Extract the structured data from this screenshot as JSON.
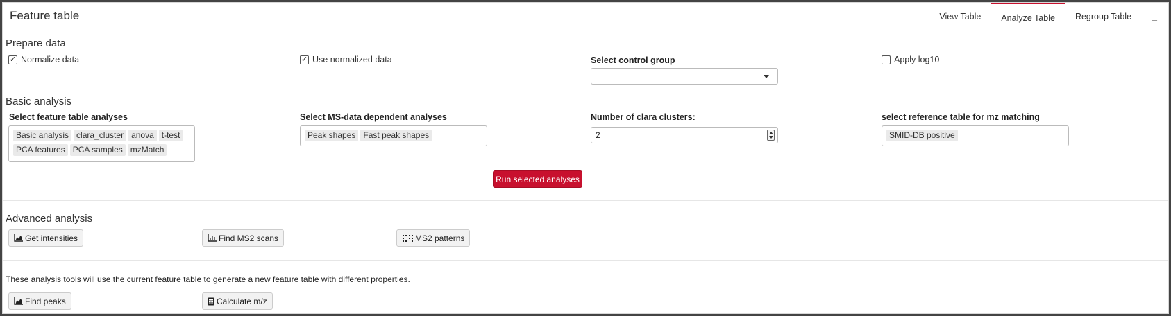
{
  "header": {
    "title": "Feature table",
    "tabs": [
      "View Table",
      "Analyze Table",
      "Regroup Table"
    ],
    "minimize": "_"
  },
  "prepare": {
    "title": "Prepare data",
    "normalize": "Normalize data",
    "use_normalized": "Use normalized data",
    "control_group_label": "Select control group",
    "control_group_value": "",
    "log10": "Apply log10"
  },
  "basic": {
    "title": "Basic analysis",
    "ft_label": "Select feature table analyses",
    "ft_tags": [
      "Basic analysis",
      "clara_cluster",
      "anova",
      "t-test",
      "PCA features",
      "PCA samples",
      "mzMatch"
    ],
    "ms_label": "Select MS-data dependent analyses",
    "ms_tags": [
      "Peak shapes",
      "Fast peak shapes"
    ],
    "clara_label": "Number of clara clusters:",
    "clara_value": "2",
    "ref_label": "select reference table for mz matching",
    "ref_tags": [
      "SMID-DB positive"
    ],
    "run_button": "Run selected analyses"
  },
  "advanced": {
    "title": "Advanced analysis",
    "get_intensities": "Get intensities",
    "find_ms2": "Find MS2 scans",
    "ms2_patterns": "MS2 patterns"
  },
  "tools": {
    "note": "These analysis tools will use the current feature table to generate a new feature table with different properties.",
    "find_peaks": "Find peaks",
    "calc_mz": "Calculate m/z"
  },
  "colors": {
    "accent": "#c8102e"
  },
  "icons": [
    "area-chart-icon",
    "grid-dots-icon",
    "calculator-icon",
    "check-icon",
    "caret-down-icon"
  ]
}
